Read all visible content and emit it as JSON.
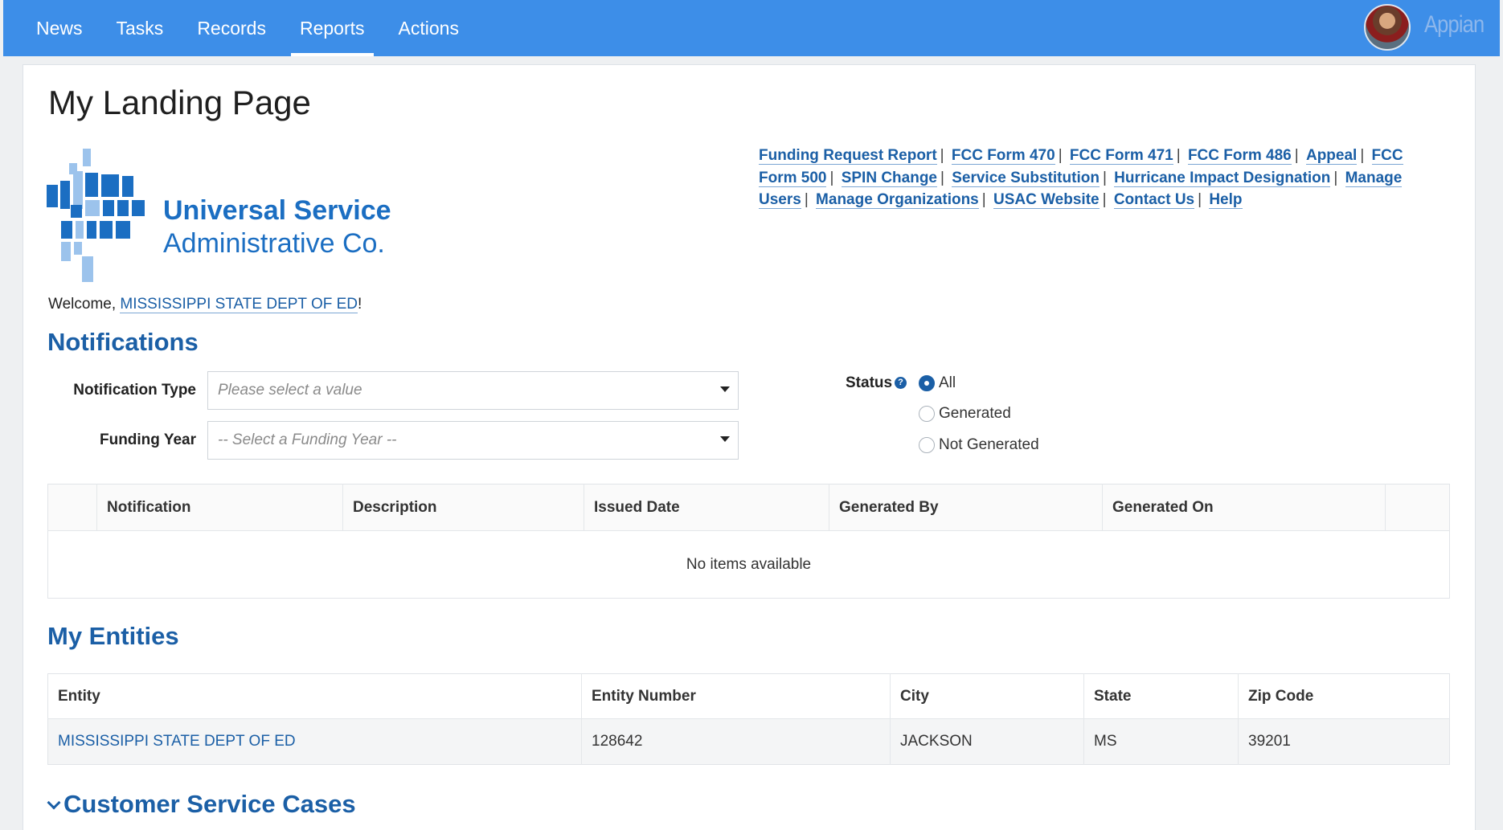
{
  "nav": {
    "items": [
      {
        "label": "News",
        "active": false
      },
      {
        "label": "Tasks",
        "active": false
      },
      {
        "label": "Records",
        "active": false
      },
      {
        "label": "Reports",
        "active": true
      },
      {
        "label": "Actions",
        "active": false
      }
    ],
    "brand": "Appian",
    "avatar_icon": "user-avatar",
    "bar_color": "#3d8ee8"
  },
  "page": {
    "title": "My Landing Page"
  },
  "logo": {
    "line1": "Universal Service",
    "line2": "Administrative Co.",
    "color": "#1b6ec2"
  },
  "quicklinks": [
    "Funding Request Report",
    "FCC Form 470",
    "FCC Form 471",
    "FCC Form 486",
    "Appeal",
    "FCC Form 500",
    "SPIN Change",
    "Service Substitution",
    "Hurricane Impact Designation",
    "Manage Users",
    "Manage Organizations",
    "USAC Website",
    "Contact Us",
    "Help"
  ],
  "welcome": {
    "prefix": "Welcome, ",
    "name": "MISSISSIPPI STATE DEPT OF ED",
    "suffix": "!"
  },
  "notifications": {
    "title": "Notifications",
    "type_label": "Notification Type",
    "type_placeholder": "Please select a value",
    "year_label": "Funding Year",
    "year_placeholder": "-- Select a Funding Year --",
    "status_label": "Status",
    "status_options": [
      {
        "label": "All",
        "selected": true
      },
      {
        "label": "Generated",
        "selected": false
      },
      {
        "label": "Not Generated",
        "selected": false
      }
    ],
    "columns": [
      "",
      "Notification",
      "Description",
      "Issued Date",
      "Generated By",
      "Generated On",
      ""
    ],
    "empty_text": "No items available"
  },
  "entities": {
    "title": "My Entities",
    "columns": [
      "Entity",
      "Entity Number",
      "City",
      "State",
      "Zip Code"
    ],
    "rows": [
      [
        "MISSISSIPPI STATE DEPT OF ED",
        "128642",
        "JACKSON",
        "MS",
        "39201"
      ]
    ]
  },
  "cases": {
    "title": "Customer Service Cases",
    "expanded": true
  }
}
